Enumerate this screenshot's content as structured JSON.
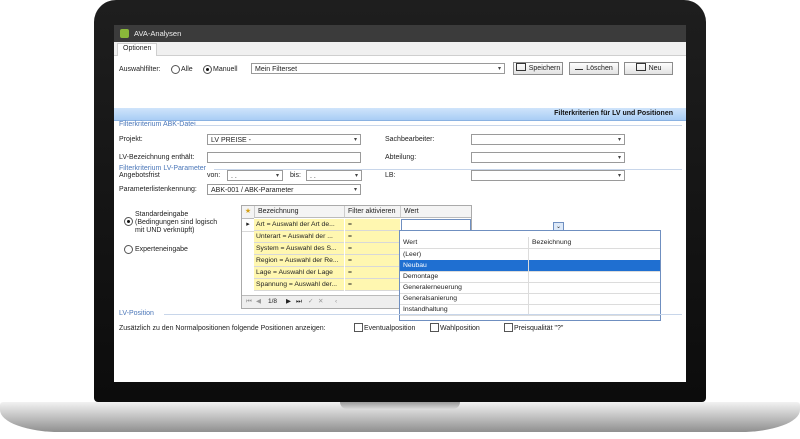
{
  "window": {
    "title": "AVA-Analysen"
  },
  "tabs": [
    {
      "label": "Optionen"
    }
  ],
  "filter_bar": {
    "label": "Auswahlfilter:",
    "radio_all": "Alle",
    "radio_manual": "Manuell",
    "selected": "manuell",
    "filterset_value": "Mein Filterset",
    "save_label": "Speichern",
    "delete_label": "Löschen",
    "new_label": "Neu"
  },
  "header_title": "Filterkriterien für LV und Positionen",
  "abk": {
    "section_title": "Filterkriterium ABK-Datei",
    "project_label": "Projekt:",
    "project_value": "LV PREISE -",
    "lv_label": "LV-Bezeichnung enthält:",
    "lv_value": "",
    "deadline_label": "Angebotsfrist",
    "from_label": "von:",
    "from_value": ". .",
    "to_label": "bis:",
    "to_value": ". .",
    "clerk_label": "Sachbearbeiter:",
    "department_label": "Abteilung:",
    "lb_label": "LB:"
  },
  "lv_params": {
    "section_title": "Filterkriterium LV-Parameter",
    "list_label": "Parameterlistenkennung:",
    "list_value": "ABK-001 / ABK-Parameter",
    "mode_standard": "Standardeingabe (Bedingungen sind logisch mit UND verknüpft)",
    "mode_expert": "Experteneingabe"
  },
  "grid": {
    "columns": [
      "Bezeichnung",
      "Filter aktivieren",
      "Wert"
    ],
    "rows": [
      {
        "name": "Art = Auswahl der Art de...",
        "op": "="
      },
      {
        "name": "Unterart = Auswahl der ...",
        "op": "="
      },
      {
        "name": "System = Auswahl des S...",
        "op": "="
      },
      {
        "name": "Region = Auswahl der Re...",
        "op": "="
      },
      {
        "name": "Lage = Auswahl der Lage",
        "op": "="
      },
      {
        "name": "Spannung = Auswahl der...",
        "op": "="
      }
    ],
    "pager": "1/8"
  },
  "dropdown": {
    "headers": [
      "Wert",
      "Bezeichnung"
    ],
    "options": [
      "(Leer)",
      "Neubau",
      "Demontage",
      "Generalerneuerung",
      "Generalsanierung",
      "Instandhaltung"
    ],
    "selected": "Neubau"
  },
  "position": {
    "section_title": "LV-Position",
    "intro": "Zusätzlich zu den Normalpositionen folgende Positionen anzeigen:",
    "opt1": "Eventualposition",
    "opt2": "Wahlposition",
    "opt3": "Preisqualität \"?\""
  },
  "colors": {
    "accent": "#1f6fd1",
    "header_band": "#a9cdf5",
    "section_text": "#4a76b8",
    "highlight_cells": "#fff7b0"
  }
}
